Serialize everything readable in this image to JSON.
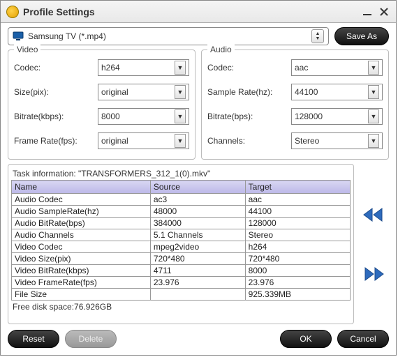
{
  "title": "Profile Settings",
  "profile_dropdown": "Samsung TV (*.mp4)",
  "save_as_label": "Save As",
  "video": {
    "legend": "Video",
    "codec_label": "Codec:",
    "codec_value": "h264",
    "size_label": "Size(pix):",
    "size_value": "original",
    "bitrate_label": "Bitrate(kbps):",
    "bitrate_value": "8000",
    "framerate_label": "Frame Rate(fps):",
    "framerate_value": "original"
  },
  "audio": {
    "legend": "Audio",
    "codec_label": "Codec:",
    "codec_value": "aac",
    "samplerate_label": "Sample Rate(hz):",
    "samplerate_value": "44100",
    "bitrate_label": "Bitrate(bps):",
    "bitrate_value": "128000",
    "channels_label": "Channels:",
    "channels_value": "Stereo"
  },
  "task": {
    "header": "Task information: \"TRANSFORMERS_312_1(0).mkv\"",
    "col_name": "Name",
    "col_source": "Source",
    "col_target": "Target",
    "rows": [
      {
        "name": "Audio Codec",
        "source": "ac3",
        "target": "aac"
      },
      {
        "name": "Audio SampleRate(hz)",
        "source": "48000",
        "target": "44100"
      },
      {
        "name": "Audio BitRate(bps)",
        "source": "384000",
        "target": "128000"
      },
      {
        "name": "Audio Channels",
        "source": "5.1 Channels",
        "target": "Stereo"
      },
      {
        "name": "Video Codec",
        "source": "mpeg2video",
        "target": "h264"
      },
      {
        "name": "Video Size(pix)",
        "source": "720*480",
        "target": "720*480"
      },
      {
        "name": "Video BitRate(kbps)",
        "source": "4711",
        "target": "8000"
      },
      {
        "name": "Video FrameRate(fps)",
        "source": "23.976",
        "target": "23.976"
      },
      {
        "name": "File Size",
        "source": "",
        "target": "925.339MB"
      }
    ],
    "free_space": "Free disk space:76.926GB"
  },
  "footer": {
    "reset": "Reset",
    "delete": "Delete",
    "ok": "OK",
    "cancel": "Cancel"
  }
}
